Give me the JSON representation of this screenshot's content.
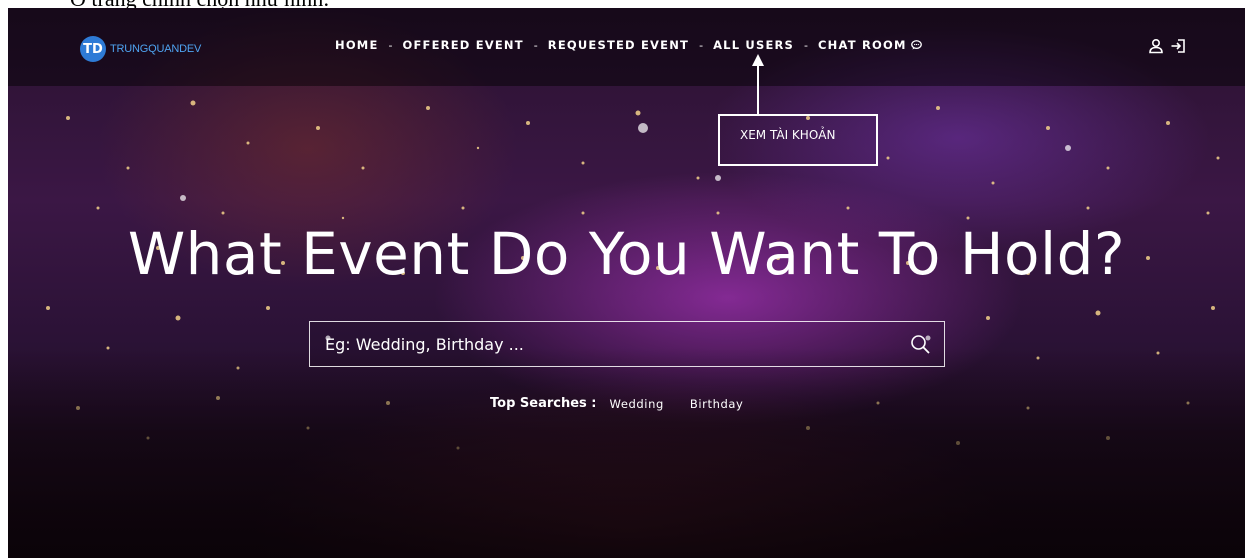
{
  "doc_fragment": "Ở trang chính chọn như hình:",
  "brand": {
    "logo_text": "TRUNGQUANDEV",
    "logo_mark": "TD",
    "accent_color": "#2e7bd6"
  },
  "nav": {
    "items": [
      {
        "label": "HOME"
      },
      {
        "label": "OFFERED EVENT"
      },
      {
        "label": "REQUESTED EVENT"
      },
      {
        "label": "ALL USERS"
      },
      {
        "label": "CHAT ROOM"
      }
    ],
    "separator": "-",
    "chat_icon": "chat-bubble-icon",
    "right_icons": [
      "user-icon",
      "sign-in-icon"
    ]
  },
  "annotation": {
    "text": "XEM TÀI KHOẢN"
  },
  "hero": {
    "headline": "What Event Do You Want To Hold?"
  },
  "search": {
    "placeholder": "Eg: Wedding, Birthday ...",
    "value": "",
    "icon": "search-icon"
  },
  "top_searches": {
    "label": "Top Searches :",
    "links": [
      "Wedding",
      "Birthday"
    ]
  }
}
